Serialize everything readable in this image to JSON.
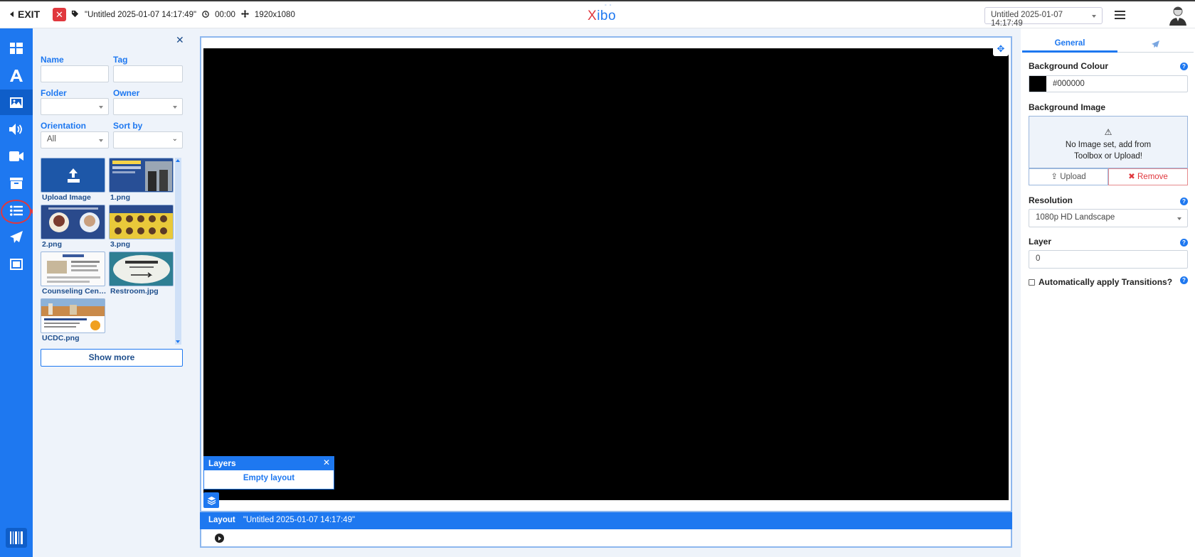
{
  "topbar": {
    "exit_label": "EXIT",
    "layout_name": "\"Untitled 2025-01-07 14:17:49\"",
    "duration": "00:00",
    "resolution": "1920x1080",
    "logo_x": "X",
    "logo_rest": "ibo",
    "logo_dots": "° °",
    "layout_select": "Untitled 2025-01-07 14:17:49"
  },
  "toolbox": {
    "name_label": "Name",
    "tag_label": "Tag",
    "folder_label": "Folder",
    "owner_label": "Owner",
    "orientation_label": "Orientation",
    "orientation_value": "All",
    "sortby_label": "Sort by",
    "items": [
      {
        "label": "Upload Image",
        "icon": "upload-icon"
      },
      {
        "label": "1.png"
      },
      {
        "label": "2.png"
      },
      {
        "label": "3.png"
      },
      {
        "label": "Counseling Center..."
      },
      {
        "label": "Restroom.jpg"
      },
      {
        "label": "UCDC.png"
      }
    ],
    "show_more": "Show more"
  },
  "editor": {
    "layers_title": "Layers",
    "layers_empty": "Empty layout",
    "bottom_label": "Layout",
    "bottom_name": "\"Untitled 2025-01-07 14:17:49\""
  },
  "properties": {
    "tab_general": "General",
    "bg_colour_label": "Background Colour",
    "bg_colour_value": "#000000",
    "bg_image_label": "Background Image",
    "bg_image_msg_1": "No Image set, add from",
    "bg_image_msg_2": "Toolbox or Upload!",
    "upload_label": "Upload",
    "remove_label": "Remove",
    "resolution_label": "Resolution",
    "resolution_value": "1080p HD Landscape",
    "layer_label": "Layer",
    "layer_value": "0",
    "transitions_label": "Automatically apply Transitions?"
  },
  "colors": {
    "accent": "#1e78f0",
    "danger": "#e0383e",
    "canvas": "#000000"
  }
}
